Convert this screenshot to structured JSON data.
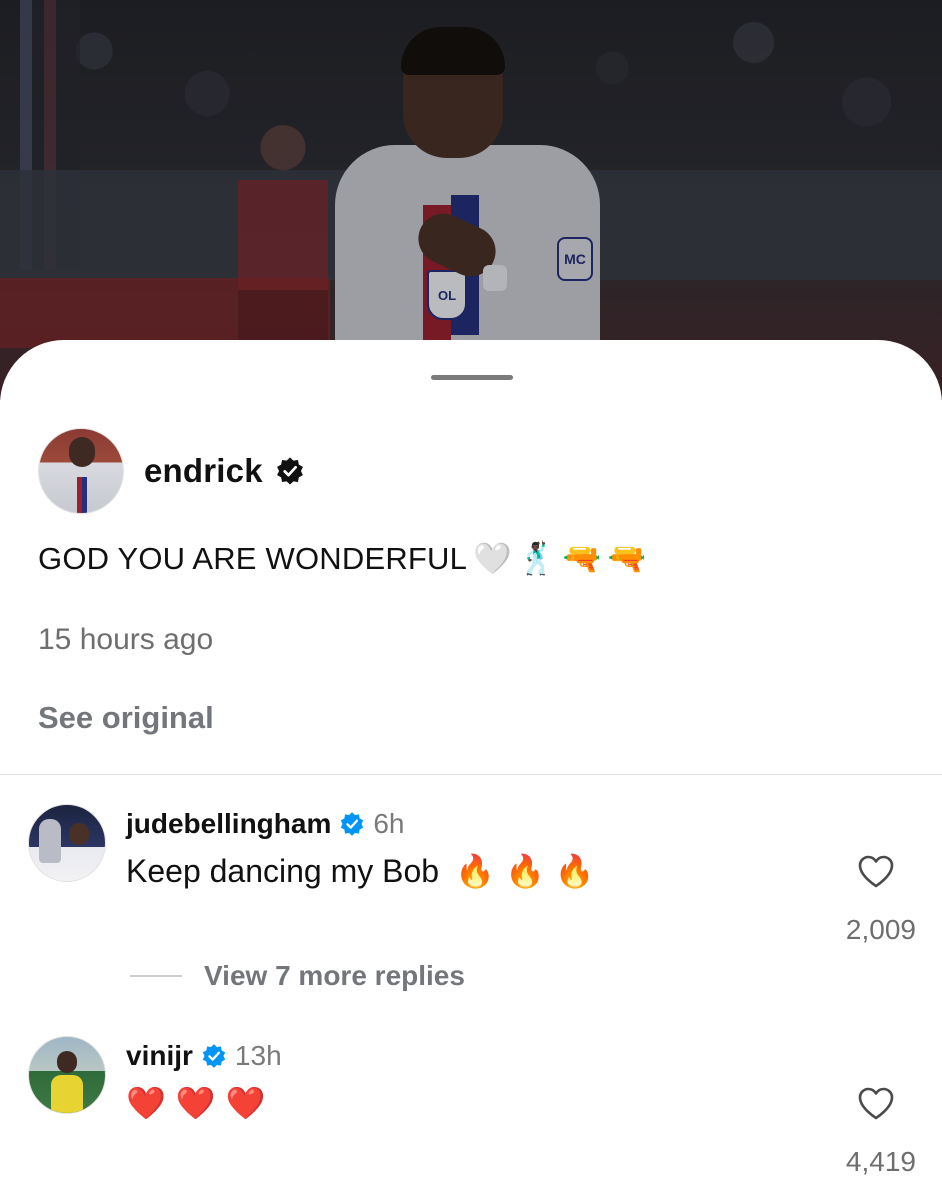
{
  "post": {
    "author": "endrick",
    "author_verified": true,
    "caption_text": "GOD YOU ARE WONDERFUL",
    "caption_emojis": [
      "🤍",
      "🕺🏿",
      "🔫",
      "🔫"
    ],
    "time_ago": "15 hours ago",
    "see_original": "See original",
    "photo_jersey_badge": "OL",
    "photo_sleeve_badge": "MC"
  },
  "comments": [
    {
      "username": "judebellingham",
      "verified": true,
      "time": "6h",
      "text": "Keep dancing my Bob",
      "emojis": [
        "🔥",
        "🔥",
        "🔥"
      ],
      "likes": "2,009",
      "view_replies": "View 7 more replies"
    },
    {
      "username": "vinijr",
      "verified": true,
      "time": "13h",
      "text": "",
      "emojis": [
        "❤️",
        "❤️",
        "❤️"
      ],
      "likes": "4,419"
    }
  ],
  "icons": {
    "verified_post": "verified-badge-black",
    "verified_comment": "verified-badge-blue",
    "like": "heart-outline-icon"
  },
  "colors": {
    "verified_blue": "#0095f6",
    "secondary_text": "#73767b"
  }
}
